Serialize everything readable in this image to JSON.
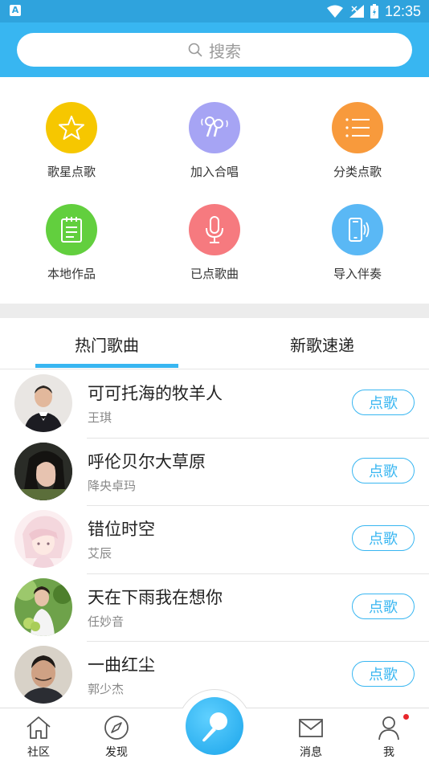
{
  "status_bar": {
    "time": "12:35",
    "left_badge": "A"
  },
  "search": {
    "placeholder": "搜索"
  },
  "features": [
    {
      "label": "歌星点歌",
      "icon": "star-icon",
      "color": "#f6c700"
    },
    {
      "label": "加入合唱",
      "icon": "duet-mic-icon",
      "color": "#a6a4f4"
    },
    {
      "label": "分类点歌",
      "icon": "list-icon",
      "color": "#f89a3c"
    },
    {
      "label": "本地作品",
      "icon": "notepad-icon",
      "color": "#62cf3e"
    },
    {
      "label": "已点歌曲",
      "icon": "microphone-icon",
      "color": "#f67a7f"
    },
    {
      "label": "导入伴奏",
      "icon": "phone-sound-icon",
      "color": "#5ab8f5"
    }
  ],
  "tabs": [
    {
      "label": "热门歌曲",
      "active": true
    },
    {
      "label": "新歌速递",
      "active": false
    }
  ],
  "songs": [
    {
      "title": "可可托海的牧羊人",
      "artist": "王琪",
      "button": "点歌"
    },
    {
      "title": "呼伦贝尔大草原",
      "artist": "降央卓玛",
      "button": "点歌"
    },
    {
      "title": "错位时空",
      "artist": "艾辰",
      "button": "点歌"
    },
    {
      "title": "天在下雨我在想你",
      "artist": "任妙音",
      "button": "点歌"
    },
    {
      "title": "一曲红尘",
      "artist": "郭少杰",
      "button": "点歌"
    }
  ],
  "bottom_nav": [
    {
      "label": "社区",
      "icon": "home-icon"
    },
    {
      "label": "发现",
      "icon": "compass-icon"
    },
    {
      "label": "消息",
      "icon": "mail-icon"
    },
    {
      "label": "我",
      "icon": "user-icon"
    }
  ],
  "colors": {
    "accent": "#38b6f1",
    "notification": "#e8262b"
  }
}
